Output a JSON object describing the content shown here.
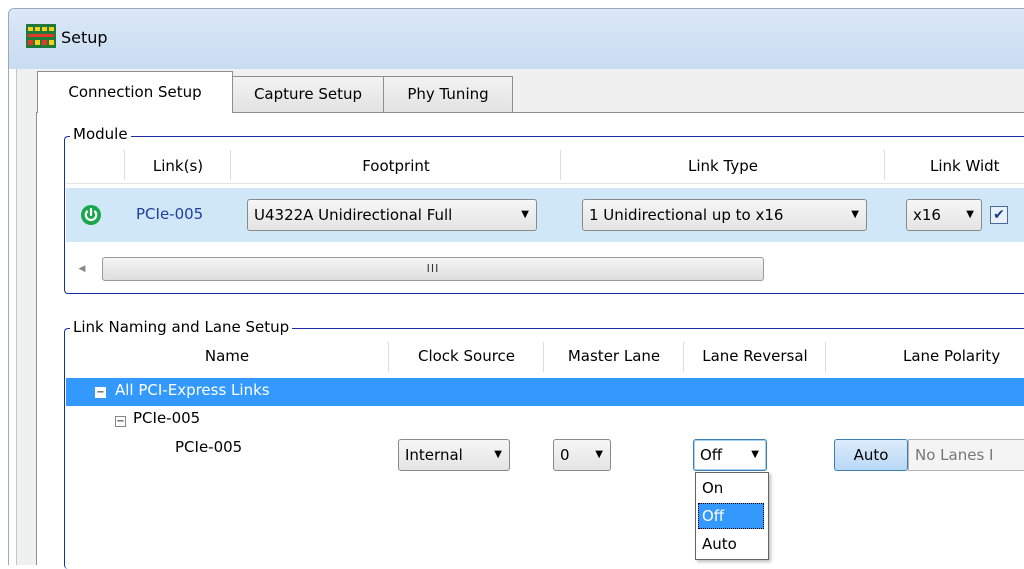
{
  "window": {
    "title": "Setup",
    "icon": "app-logo-icon"
  },
  "tabs": [
    {
      "label": "Connection Setup",
      "active": true
    },
    {
      "label": "Capture Setup",
      "active": false
    },
    {
      "label": "Phy Tuning",
      "active": false
    }
  ],
  "module": {
    "legend": "Module",
    "columns": {
      "links": "Link(s)",
      "footprint": "Footprint",
      "link_type": "Link Type",
      "link_width": "Link Widt"
    },
    "row": {
      "status_icon": "power-on-icon",
      "link": "PCIe-005",
      "footprint": "U4322A Unidirectional Full",
      "link_type": "1 Unidirectional up to x16",
      "link_width": "x16",
      "checkbox_checked": true
    },
    "scrollbar_grip": "III"
  },
  "naming": {
    "legend": "Link Naming and Lane Setup",
    "columns": {
      "name": "Name",
      "clock_source": "Clock Source",
      "master_lane": "Master Lane",
      "lane_reversal": "Lane Reversal",
      "lane_polarity": "Lane Polarity"
    },
    "tree": {
      "root": "All PCI-Express Links",
      "child": "PCIe-005",
      "leaf": "PCIe-005"
    },
    "row": {
      "clock_source": "Internal",
      "master_lane": "0",
      "lane_reversal": "Off",
      "polarity_auto": "Auto",
      "polarity_text": "No Lanes I"
    },
    "lane_reversal_options": [
      "On",
      "Off",
      "Auto"
    ],
    "lane_reversal_selected": "Off"
  },
  "colors": {
    "selection_blue": "#3399ff",
    "group_border": "#1a2ba6",
    "link_text": "#1f3f9a",
    "power_green": "#1aa64a"
  }
}
